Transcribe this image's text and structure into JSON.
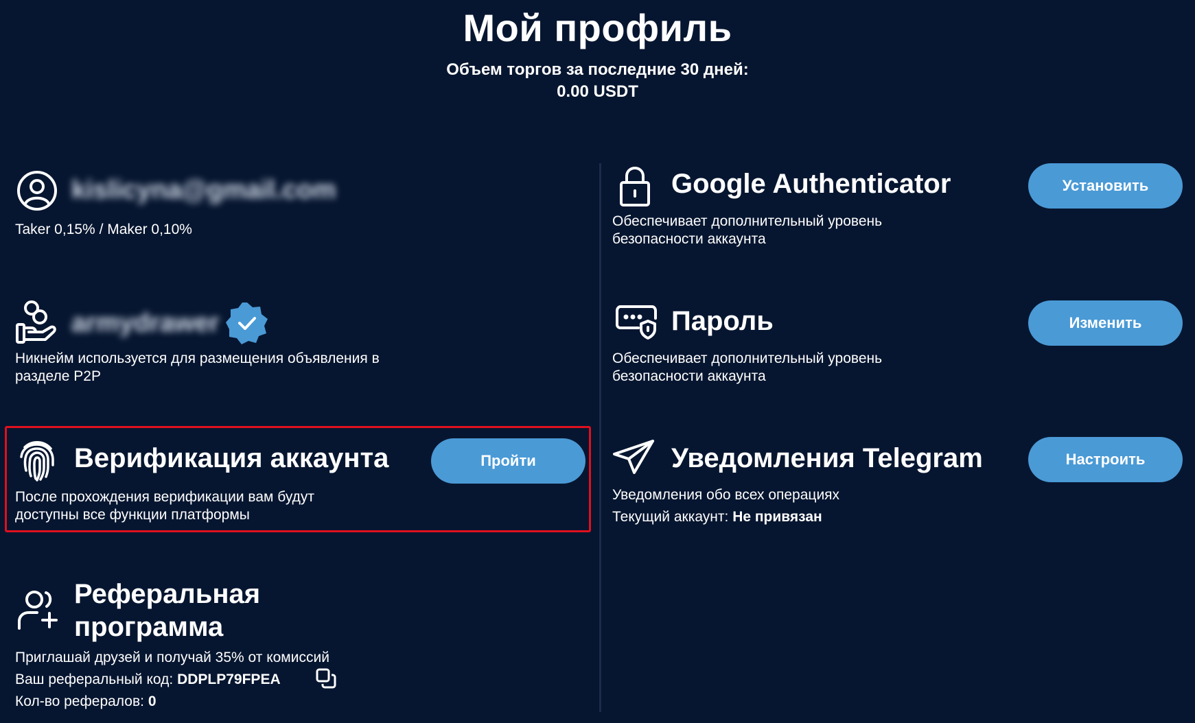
{
  "header": {
    "title": "Мой профиль",
    "volume_label": "Объем торгов за последние 30 дней:",
    "volume_value": "0.00 USDT"
  },
  "account": {
    "email": "kislicyna@gmail.com",
    "fees": "Taker 0,15% / Maker 0,10%",
    "icon": "user-circle-icon"
  },
  "nickname": {
    "value": "armydrawer",
    "description_line1": "Никнейм используется для размещения объявления в",
    "description_line2": "разделе P2P",
    "icon": "hand-coins-icon",
    "badge_icon": "verified-badge-icon"
  },
  "verification": {
    "title": "Верификация аккаунта",
    "button_label": "Пройти",
    "description_line1": "После прохождения верификации вам будут",
    "description_line2": "доступны все функции платформы",
    "icon": "fingerprint-icon"
  },
  "referral": {
    "title_line1": "Реферальная",
    "title_line2": "программа",
    "promo": "Приглашай друзей и получай 35% от комиссий",
    "code_label": "Ваш реферальный код:",
    "code_value": "DDPLP79FPEA",
    "count_label": "Кол-во рефералов:",
    "count_value": "0",
    "icon": "user-plus-icon",
    "copy_icon": "copy-icon"
  },
  "google_auth": {
    "title": "Google Authenticator",
    "button_label": "Установить",
    "description_line1": "Обеспечивает дополнительный уровень",
    "description_line2": "безопасности аккаунта",
    "icon": "lock-icon"
  },
  "password": {
    "title": "Пароль",
    "button_label": "Изменить",
    "description_line1": "Обеспечивает дополнительный уровень",
    "description_line2": "безопасности аккаунта",
    "icon": "password-shield-icon"
  },
  "telegram": {
    "title": "Уведомления Telegram",
    "button_label": "Настроить",
    "description": "Уведомления обо всех операциях",
    "account_label": "Текущий аккаунт:",
    "account_value": "Не привязан",
    "icon": "paper-plane-icon"
  },
  "colors": {
    "background": "#071630",
    "button": "#4a9ad6",
    "highlight": "#e0101e"
  }
}
